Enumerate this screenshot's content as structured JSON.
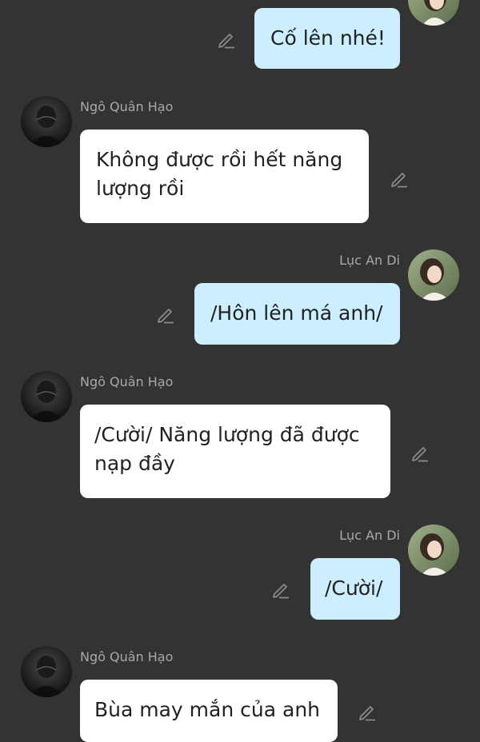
{
  "colors": {
    "background": "#333333",
    "incoming_bubble": "#ffffff",
    "outgoing_bubble": "#cdeeff",
    "name_text": "#a8a8a8",
    "message_text": "#222222",
    "edit_icon": "#8a8a8a"
  },
  "icons": {
    "edit": "pencil-icon"
  },
  "messages": [
    {
      "direction": "out",
      "sender": "",
      "lines": [
        "Cố lên nhé!"
      ]
    },
    {
      "direction": "in",
      "sender": "Ngô Quân Hạo",
      "lines": [
        "Không được rồi hết năng",
        "lượng rồi"
      ]
    },
    {
      "direction": "out",
      "sender": "Lục An Di",
      "lines": [
        "/Hôn lên má anh/"
      ]
    },
    {
      "direction": "in",
      "sender": "Ngô Quân Hạo",
      "lines": [
        "/Cười/ Năng lượng đã được",
        "nạp đầy"
      ]
    },
    {
      "direction": "out",
      "sender": "Lục An Di",
      "lines": [
        "/Cười/"
      ]
    },
    {
      "direction": "in",
      "sender": "Ngô Quân Hạo",
      "lines": [
        "Bùa may mắn của anh"
      ]
    }
  ]
}
